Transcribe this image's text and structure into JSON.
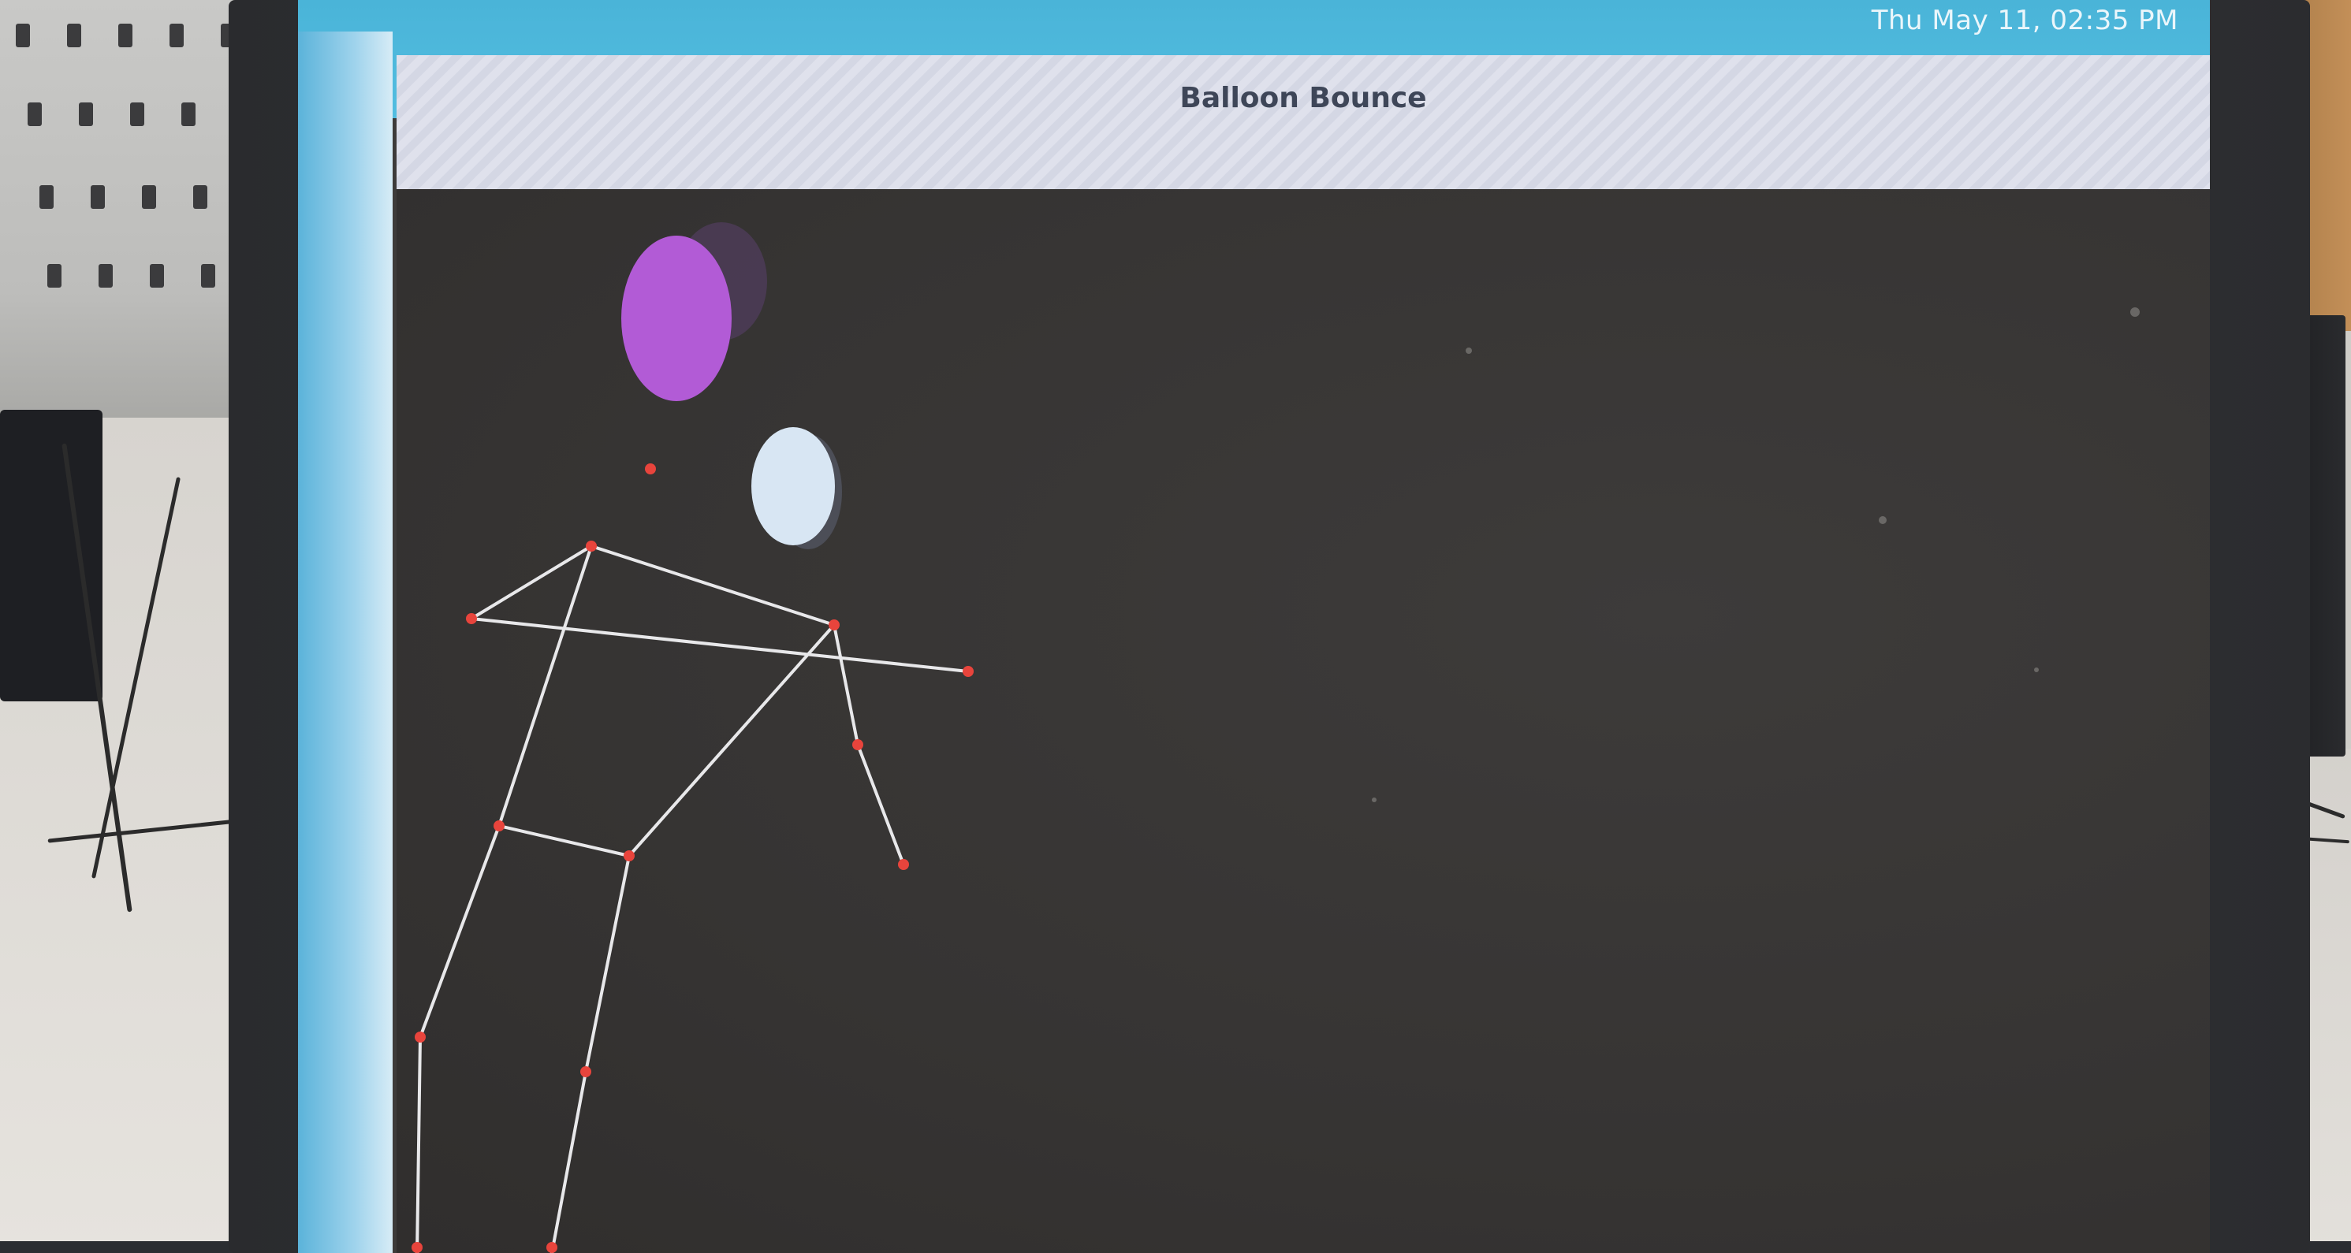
{
  "system": {
    "clock": "Thu May 11, 02:35 PM"
  },
  "window": {
    "title": "Balloon Bounce"
  },
  "game": {
    "balloons": [
      {
        "name": "purple-balloon",
        "color": "#b25bd6",
        "shadow_color": "#5a3f6b"
      },
      {
        "name": "white-balloon",
        "color": "#d8e6f3",
        "shadow_color": "#4c4e57"
      }
    ],
    "skeleton": {
      "line_color": "#e8e8ea",
      "joint_color": "#e8443c"
    }
  },
  "colors": {
    "taskbar": "#4ab4d8",
    "titlebar": "#dfe1ec",
    "canvas": "#3b3937"
  }
}
